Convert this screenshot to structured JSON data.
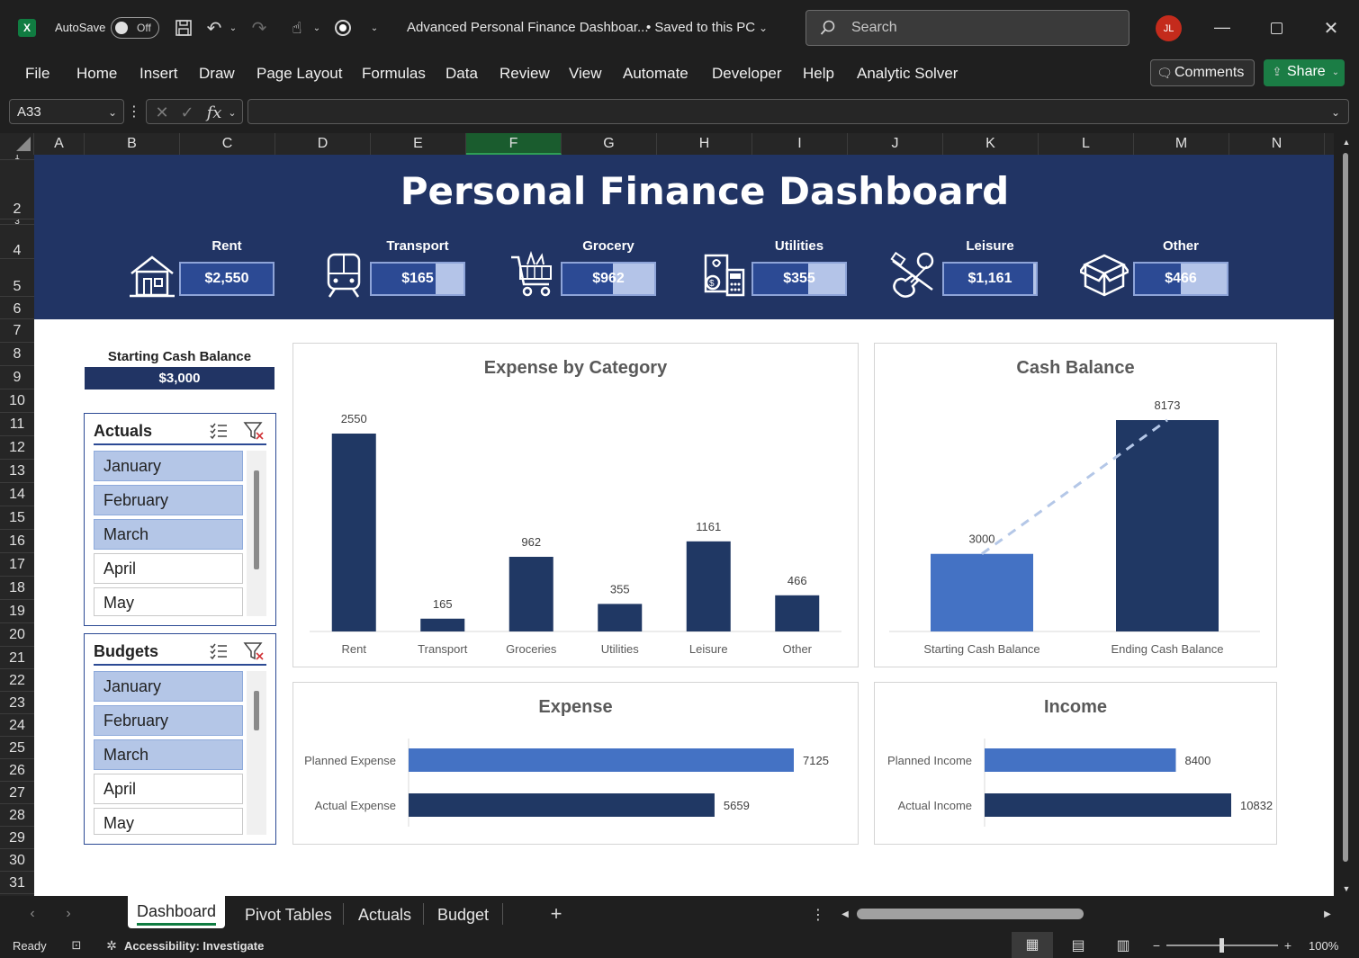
{
  "titlebar": {
    "autosave_label": "AutoSave",
    "autosave_state": "Off",
    "doc_title": "Advanced Personal Finance Dashboar...",
    "saved_status": "• Saved to this PC",
    "search_placeholder": "Search",
    "user_initials": "JL"
  },
  "ribbon": {
    "menu": [
      "File",
      "Home",
      "Insert",
      "Draw",
      "Page Layout",
      "Formulas",
      "Data",
      "Review",
      "View",
      "Automate",
      "Developer",
      "Help",
      "Analytic Solver"
    ],
    "comments_label": "Comments",
    "share_label": "Share"
  },
  "formula_bar": {
    "name_box": "A33",
    "formula": ""
  },
  "columns": [
    "A",
    "B",
    "C",
    "D",
    "E",
    "F",
    "G",
    "H",
    "I",
    "J",
    "K",
    "L",
    "M",
    "N"
  ],
  "rows": [
    "1",
    "2",
    "3",
    "4",
    "5",
    "6",
    "7",
    "8",
    "9",
    "10",
    "11",
    "12",
    "13",
    "14",
    "15",
    "16",
    "17",
    "18",
    "19",
    "20",
    "21",
    "22",
    "23",
    "24",
    "25",
    "26",
    "27",
    "28",
    "29",
    "30",
    "31"
  ],
  "dashboard": {
    "title": "Personal Finance Dashboard",
    "kpis": [
      {
        "label": "Rent",
        "value": "$2,550",
        "fill": 1.0,
        "icon": "house-icon"
      },
      {
        "label": "Transport",
        "value": "$165",
        "fill": 0.7,
        "icon": "train-icon"
      },
      {
        "label": "Grocery",
        "value": "$962",
        "fill": 0.55,
        "icon": "shopping-cart-icon"
      },
      {
        "label": "Utilities",
        "value": "$355",
        "fill": 0.6,
        "icon": "utility-bills-icon"
      },
      {
        "label": "Leisure",
        "value": "$1,161",
        "fill": 0.97,
        "icon": "leisure-guitar-icon"
      },
      {
        "label": "Other",
        "value": "$466",
        "fill": 0.5,
        "icon": "box-icon"
      }
    ],
    "starting_cash_label": "Starting Cash Balance",
    "starting_cash_value": "$3,000",
    "slicers": [
      {
        "title": "Actuals",
        "items": [
          "January",
          "February",
          "March",
          "April",
          "May"
        ],
        "selected": [
          true,
          true,
          true,
          false,
          false
        ]
      },
      {
        "title": "Budgets",
        "items": [
          "January",
          "February",
          "March",
          "April",
          "May"
        ],
        "selected": [
          true,
          true,
          true,
          false,
          false
        ]
      }
    ]
  },
  "chart_data": [
    {
      "type": "bar",
      "title": "Expense by Category",
      "categories": [
        "Rent",
        "Transport",
        "Groceries",
        "Utilities",
        "Leisure",
        "Other"
      ],
      "values": [
        2550,
        165,
        962,
        355,
        1161,
        466
      ],
      "ylim": [
        0,
        2550
      ],
      "color": "#203864"
    },
    {
      "type": "bar",
      "title": "Cash Balance",
      "categories": [
        "Starting Cash Balance",
        "Ending Cash Balance"
      ],
      "values": [
        3000,
        8173
      ],
      "ylim": [
        0,
        8173
      ],
      "colors": [
        "#4472c4",
        "#203864"
      ],
      "trendline": "dashed"
    },
    {
      "type": "bar",
      "orientation": "horizontal",
      "title": "Expense",
      "categories": [
        "Planned Expense",
        "Actual Expense"
      ],
      "values": [
        7125,
        5659
      ],
      "xlim": [
        0,
        7125
      ],
      "colors": [
        "#4472c4",
        "#203864"
      ]
    },
    {
      "type": "bar",
      "orientation": "horizontal",
      "title": "Income",
      "categories": [
        "Planned Income",
        "Actual Income"
      ],
      "values": [
        8400,
        10832
      ],
      "xlim": [
        0,
        10832
      ],
      "colors": [
        "#4472c4",
        "#203864"
      ]
    }
  ],
  "sheet_tabs": [
    "Dashboard",
    "Pivot Tables",
    "Actuals",
    "Budget"
  ],
  "active_tab": "Dashboard",
  "status": {
    "ready": "Ready",
    "accessibility": "Accessibility: Investigate",
    "zoom": "100%"
  }
}
